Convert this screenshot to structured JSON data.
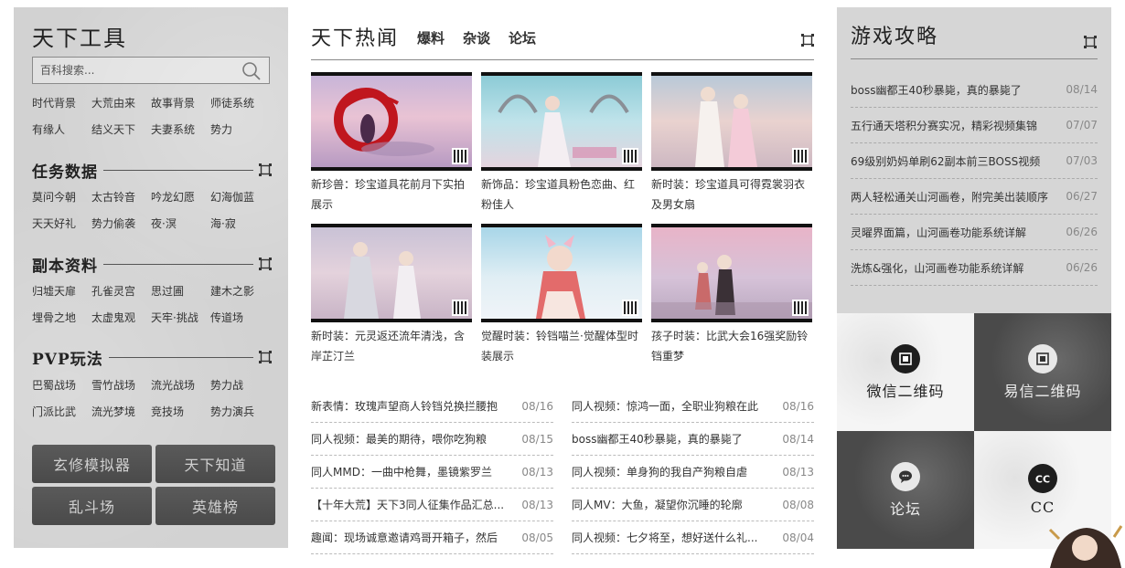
{
  "left": {
    "title": "天下工具",
    "search_placeholder": "百科搜索...",
    "tool_links": [
      "时代背景",
      "大荒由来",
      "故事背景",
      "师徒系统",
      "有缘人",
      "结义天下",
      "夫妻系统",
      "势力"
    ],
    "sections": [
      {
        "title": "任务数据",
        "links": [
          "莫问今朝",
          "太古铃音",
          "吟龙幻愿",
          "幻海伽蓝",
          "天天好礼",
          "势力偷袭",
          "夜·溟",
          "海·寂"
        ]
      },
      {
        "title": "副本资料",
        "links": [
          "归墟天扉",
          "孔雀灵宫",
          "思过圃",
          "建木之影",
          "埋骨之地",
          "太虚鬼观",
          "天牢·挑战",
          "传道场"
        ]
      },
      {
        "title": "PVP玩法",
        "links": [
          "巴蜀战场",
          "雪竹战场",
          "流光战场",
          "势力战",
          "门派比武",
          "流光梦境",
          "竞技场",
          "势力演兵"
        ]
      }
    ],
    "buttons": [
      "玄修模拟器",
      "天下知道",
      "乱斗场",
      "英雄榜"
    ]
  },
  "middle": {
    "title": "天下热闻",
    "tabs": [
      "爆料",
      "杂谈",
      "论坛"
    ],
    "thumbs": [
      {
        "caption": "新珍兽：珍宝道具花前月下实拍展示"
      },
      {
        "caption": "新饰品：珍宝道具粉色恋曲、红粉佳人"
      },
      {
        "caption": "新时装：珍宝道具可得霓裳羽衣及男女扇"
      },
      {
        "caption": "新时装：元灵返还流年清浅，含岸芷汀兰"
      },
      {
        "caption": "觉醒时装：铃铛喵兰·觉醒体型时装展示"
      },
      {
        "caption": "孩子时装：比武大会16强奖励铃铛重梦"
      }
    ],
    "news_left": [
      {
        "title": "新表情：玫瑰声望商人铃铛兑换拦腰抱",
        "date": "08/16"
      },
      {
        "title": "同人视频：最美的期待，喂你吃狗粮",
        "date": "08/15"
      },
      {
        "title": "同人MMD：一曲中枪舞，墨镜紫罗兰",
        "date": "08/13"
      },
      {
        "title": "【十年大荒】天下3同人征集作品汇总...",
        "date": "08/13"
      },
      {
        "title": "趣闻：现场诚意邀请鸡哥开箱子，然后",
        "date": "08/05"
      }
    ],
    "news_right": [
      {
        "title": "同人视频：惊鸿一面，全职业狗粮在此",
        "date": "08/16"
      },
      {
        "title": "boss幽都王40秒暴毙，真的暴毙了",
        "date": "08/14"
      },
      {
        "title": "同人视频：单身狗的我自产狗粮自虐",
        "date": "08/13"
      },
      {
        "title": "同人MV：大鱼，凝望你沉睡的轮廓",
        "date": "08/08"
      },
      {
        "title": "同人视频：七夕将至，想好送什么礼...",
        "date": "08/04"
      }
    ]
  },
  "right": {
    "title": "游戏攻略",
    "guides": [
      {
        "title": "boss幽都王40秒暴毙，真的暴毙了",
        "date": "08/14"
      },
      {
        "title": "五行通天塔积分赛实况，精彩视频集锦",
        "date": "07/07"
      },
      {
        "title": "69级别奶妈单刷62副本前三BOSS视频",
        "date": "07/03"
      },
      {
        "title": "两人轻松通关山河画卷，附完美出装顺序",
        "date": "06/27"
      },
      {
        "title": "灵曜界面篇，山河画卷功能系统详解",
        "date": "06/26"
      },
      {
        "title": "洗炼&强化，山河画卷功能系统详解",
        "date": "06/26"
      }
    ],
    "tiles": [
      "微信二维码",
      "易信二维码",
      "论坛",
      "CC"
    ]
  },
  "colors": {
    "panel_gray": "#d2d2d2",
    "button_dark": "#4a4a4a",
    "date_gray": "#888888"
  }
}
